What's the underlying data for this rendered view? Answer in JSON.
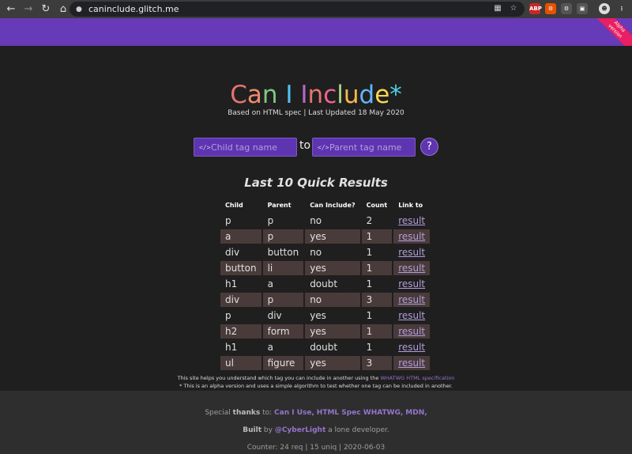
{
  "browser": {
    "url": "caninclude.glitch.me"
  },
  "ribbon": {
    "line1": "Alpha",
    "line2": "version"
  },
  "header": {
    "title_letters": [
      {
        "ch": "C",
        "color": "#e57373"
      },
      {
        "ch": "a",
        "color": "#f08c6e"
      },
      {
        "ch": "n",
        "color": "#81c784"
      },
      {
        "ch": " ",
        "color": "#ffffff"
      },
      {
        "ch": "I",
        "color": "#4fc3f7"
      },
      {
        "ch": " ",
        "color": "#ffffff"
      },
      {
        "ch": "I",
        "color": "#ba68c8"
      },
      {
        "ch": "n",
        "color": "#e57373"
      },
      {
        "ch": "c",
        "color": "#f06292"
      },
      {
        "ch": "l",
        "color": "#aed581"
      },
      {
        "ch": "u",
        "color": "#ffb74d"
      },
      {
        "ch": "d",
        "color": "#64b5f6"
      },
      {
        "ch": "e",
        "color": "#ffd54f"
      },
      {
        "ch": "*",
        "color": "#4dd0e1"
      }
    ],
    "subtitle": "Based on HTML spec | Last Updated 18 May 2020"
  },
  "search": {
    "child_placeholder": "Child tag name",
    "to_label": "to",
    "parent_placeholder": "Parent tag name",
    "help_label": "?"
  },
  "results": {
    "title": "Last 10 Quick Results",
    "columns": [
      "Child",
      "Parent",
      "Can Include?",
      "Count",
      "Link to"
    ],
    "rows": [
      {
        "child": "p",
        "parent": "p",
        "can": "no",
        "count": "2",
        "link": "result"
      },
      {
        "child": "a",
        "parent": "p",
        "can": "yes",
        "count": "1",
        "link": "result"
      },
      {
        "child": "div",
        "parent": "button",
        "can": "no",
        "count": "1",
        "link": "result"
      },
      {
        "child": "button",
        "parent": "li",
        "can": "yes",
        "count": "1",
        "link": "result"
      },
      {
        "child": "h1",
        "parent": "a",
        "can": "doubt",
        "count": "1",
        "link": "result"
      },
      {
        "child": "div",
        "parent": "p",
        "can": "no",
        "count": "3",
        "link": "result"
      },
      {
        "child": "p",
        "parent": "div",
        "can": "yes",
        "count": "1",
        "link": "result"
      },
      {
        "child": "h2",
        "parent": "form",
        "can": "yes",
        "count": "1",
        "link": "result"
      },
      {
        "child": "h1",
        "parent": "a",
        "can": "doubt",
        "count": "1",
        "link": "result"
      },
      {
        "child": "ul",
        "parent": "figure",
        "can": "yes",
        "count": "3",
        "link": "result"
      }
    ]
  },
  "notes": {
    "line1_text": "This site helps you understand which tag you can include in another using the",
    "line1_link": "WHATWG HTML specification",
    "line2_text": "* This is an alpha version and uses a simple algorithm to test whether one tag can be included in another."
  },
  "footer": {
    "thanks_prefix": "Special",
    "thanks_bold": "thanks",
    "thanks_to": "to:",
    "thanks_links": [
      "Can I Use,",
      "HTML Spec WHATWG,",
      "MDN,"
    ],
    "built_bold": "Built",
    "built_by": "by",
    "built_link": "@CyberLight",
    "built_suffix": "a lone developer.",
    "counter": "Counter: 24 req | 15 uniq | 2020-06-03"
  },
  "colors": {
    "accent": "#673ab7",
    "ribbon": "#e91e63",
    "yes": "#80cbc4",
    "no": "#ef7a7a",
    "doubt": "#ffd54f"
  }
}
